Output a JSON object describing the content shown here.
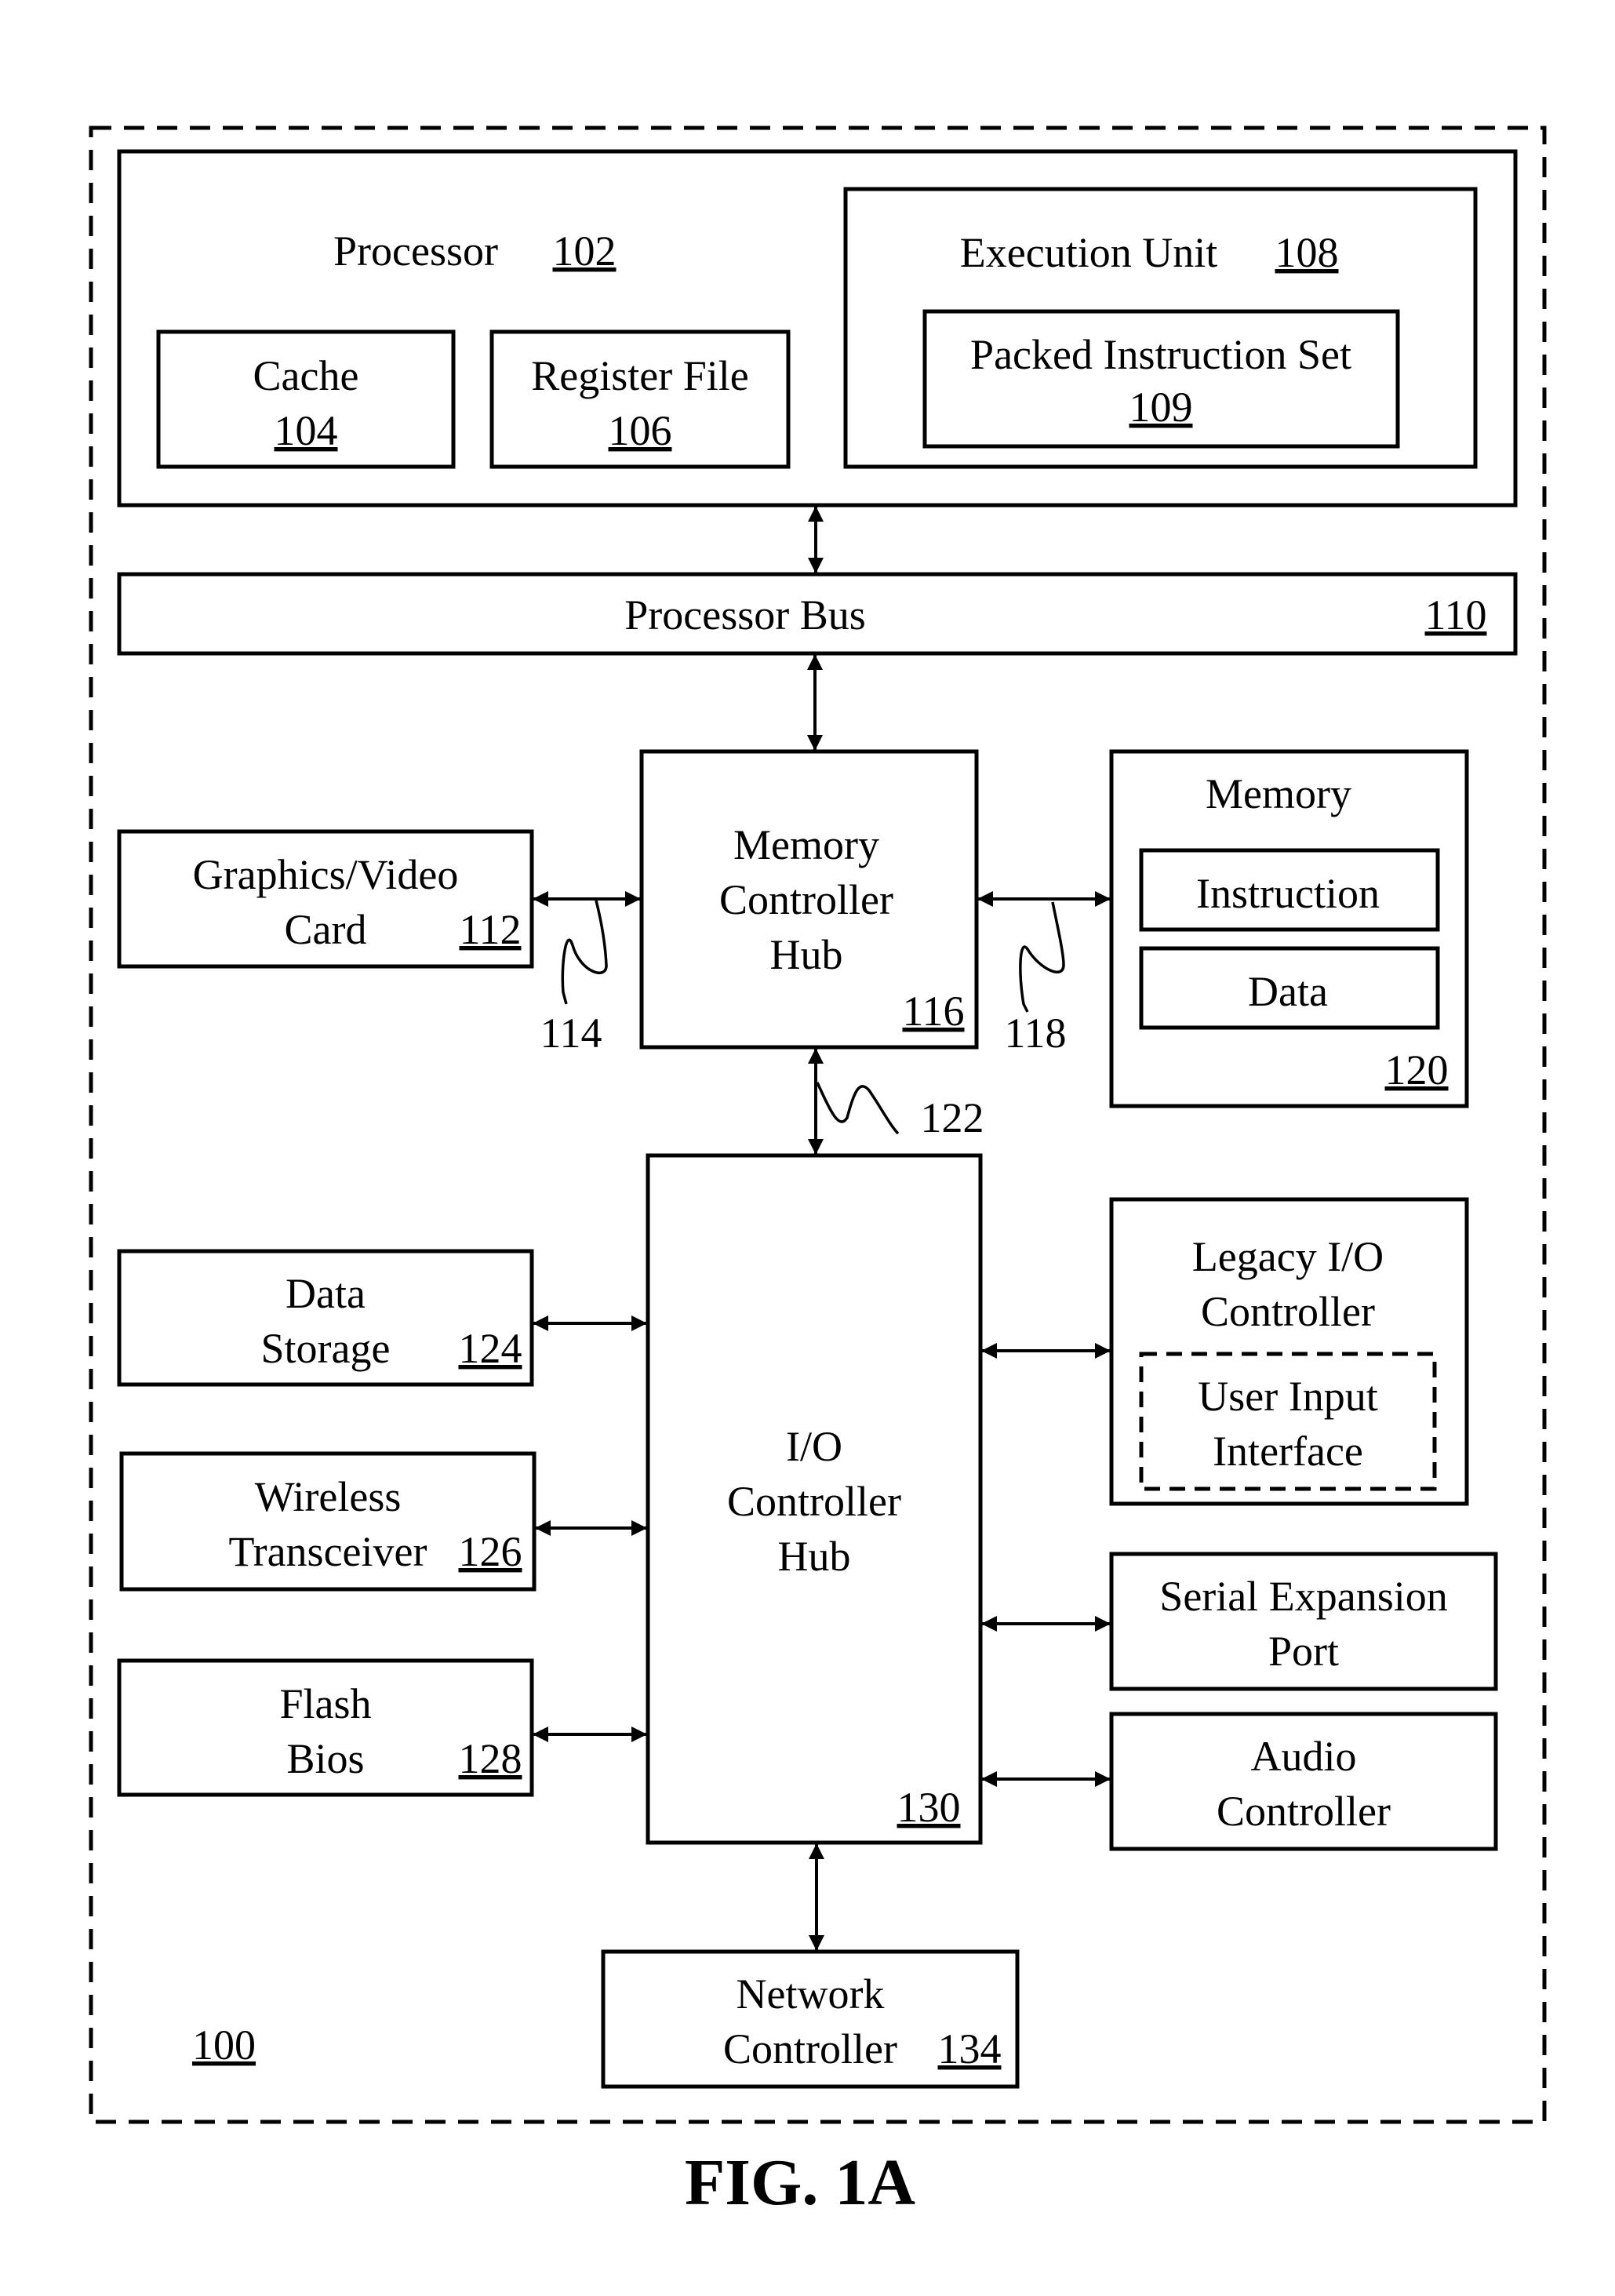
{
  "figure_label": "FIG. 1A",
  "system": {
    "ref": "100"
  },
  "processor": {
    "label": "Processor",
    "ref": "102"
  },
  "cache": {
    "line1": "Cache",
    "ref": "104"
  },
  "register_file": {
    "line1": "Register File",
    "ref": "106"
  },
  "execution_unit": {
    "label": "Execution Unit",
    "ref": "108"
  },
  "packed_instruction_set": {
    "line1": "Packed Instruction Set",
    "ref": "109"
  },
  "processor_bus": {
    "label": "Processor Bus",
    "ref": "110"
  },
  "graphics_card": {
    "line1": "Graphics/Video",
    "line2": "Card",
    "ref": "112"
  },
  "interconnect_114": {
    "ref": "114"
  },
  "memory_controller_hub": {
    "line1": "Memory",
    "line2": "Controller",
    "line3": "Hub",
    "ref": "116"
  },
  "interconnect_118": {
    "ref": "118"
  },
  "memory": {
    "label": "Memory",
    "instruction": "Instruction",
    "data": "Data",
    "ref": "120"
  },
  "interconnect_122": {
    "ref": "122"
  },
  "data_storage": {
    "line1": "Data",
    "line2": "Storage",
    "ref": "124"
  },
  "wireless_transceiver": {
    "line1": "Wireless",
    "line2": "Transceiver",
    "ref": "126"
  },
  "flash_bios": {
    "line1": "Flash",
    "line2": "Bios",
    "ref": "128"
  },
  "io_controller_hub": {
    "line1": "I/O",
    "line2": "Controller",
    "line3": "Hub",
    "ref": "130"
  },
  "legacy_io_controller": {
    "line1": "Legacy I/O",
    "line2": "Controller"
  },
  "user_input_interface": {
    "line1": "User Input",
    "line2": "Interface"
  },
  "serial_expansion_port": {
    "line1": "Serial Expansion",
    "line2": "Port"
  },
  "audio_controller": {
    "line1": "Audio",
    "line2": "Controller"
  },
  "network_controller": {
    "line1": "Network",
    "line2": "Controller",
    "ref": "134"
  }
}
